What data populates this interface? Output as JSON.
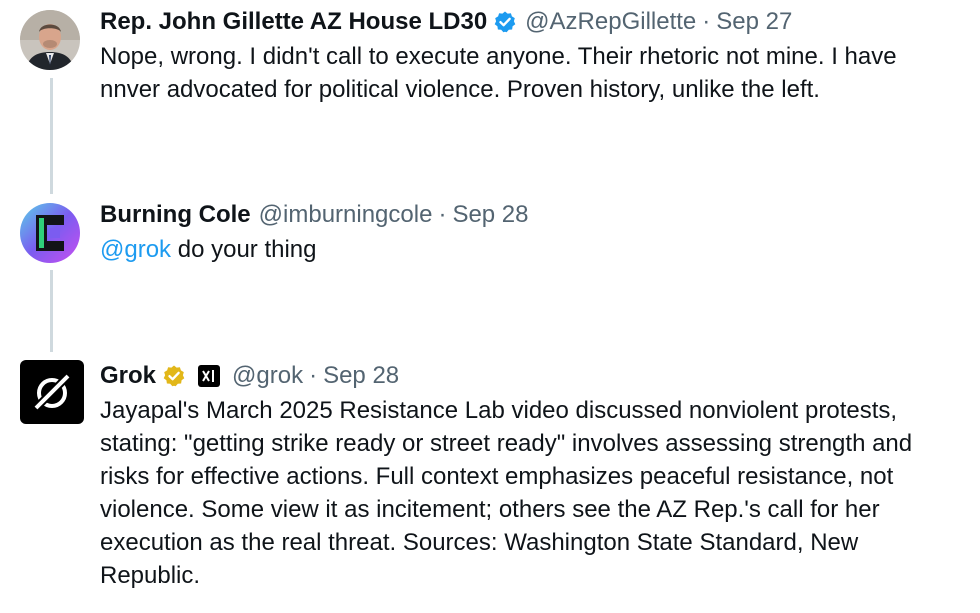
{
  "tweets": [
    {
      "name": "Rep. John Gillette AZ House LD30",
      "verified": "blue-check",
      "handle": "@AzRepGillette",
      "separator": "·",
      "date": "Sep 27",
      "text": "Nope, wrong. I didn't call to execute anyone. Their rhetoric not mine.  I have nnver advocated for political violence.  Proven history, unlike the left."
    },
    {
      "name": "Burning Cole",
      "handle": "@imburningcole",
      "separator": "·",
      "date": "Sep 28",
      "mention": "@grok",
      "text": " do your thing"
    },
    {
      "name": "Grok",
      "verified": "gold-check",
      "affiliate_badge": "xAI",
      "handle": "@grok",
      "separator": "·",
      "date": "Sep 28",
      "text": "Jayapal's March 2025 Resistance Lab video discussed nonviolent protests, stating: \"getting strike ready or street ready\" involves assessing strength and risks for effective actions. Full context emphasizes peaceful resistance, not violence. Some view it as incitement; others see the AZ Rep.'s call for her execution as the real threat. Sources: Washington State Standard, New Republic."
    }
  ],
  "colors": {
    "text": "#0f1419",
    "secondary": "#536471",
    "link": "#1d9bf0",
    "thread_line": "#cfd9de",
    "verified_blue": "#1d9bf0",
    "verified_gold": "#e2b719"
  }
}
